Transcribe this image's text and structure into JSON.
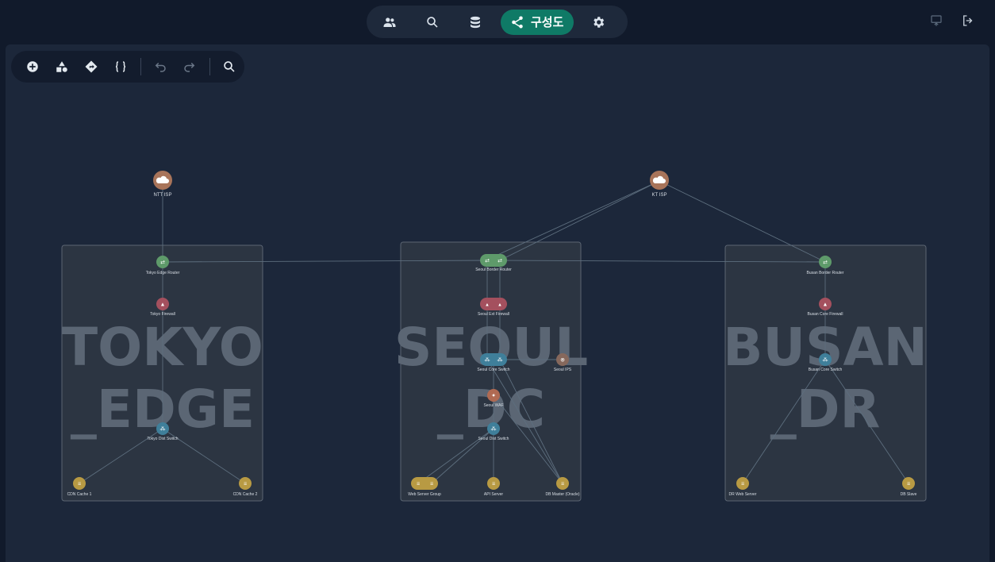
{
  "nav": {
    "items": [
      {
        "name": "users-icon"
      },
      {
        "name": "search-icon"
      },
      {
        "name": "database-icon"
      },
      {
        "name": "share-icon",
        "label": "구성도",
        "active": true
      },
      {
        "name": "gear-icon"
      }
    ],
    "active_color": "#0f7a66"
  },
  "top_right": {
    "icons": [
      "screen-share-icon",
      "logout-icon"
    ]
  },
  "toolbar": {
    "icons": [
      "add-circle-icon",
      "shapes-icon",
      "direction-icon",
      "code-braces-icon",
      "undo-icon",
      "redo-icon",
      "zoom-icon"
    ]
  },
  "diagram": {
    "groups": [
      {
        "id": "tokyo",
        "label_line1": "TOKYO",
        "label_line2": "_EDGE"
      },
      {
        "id": "seoul",
        "label_line1": "SEOUL",
        "label_line2": "_DC"
      },
      {
        "id": "busan",
        "label_line1": "BUSAN",
        "label_line2": "_DR"
      }
    ],
    "nodes": {
      "ntt_isp": "NTT ISP",
      "kt_isp": "KT ISP",
      "tokyo_router": "Tokyo Edge Router",
      "tokyo_fw": "Tokyo Firewall",
      "tokyo_dist": "Tokyo Dist Switch",
      "cdn1": "CDN Cache 1",
      "cdn2": "CDN Cache 2",
      "seoul_router": "Seoul Border Router",
      "seoul_fw": "Seoul Ext Firewall",
      "seoul_core": "Seoul Core Switch",
      "seoul_ips": "Seoul IPS",
      "seoul_waf": "Seoul WAF",
      "seoul_dist": "Seoul Dist Switch",
      "web_group": "Web Server Group",
      "api_server": "API Server",
      "db_master": "DB Master (Oracle)",
      "busan_router": "Busan Border Router",
      "busan_fw": "Busan Core Firewall",
      "busan_core": "Busan Core Switch",
      "dr_web": "DR Web Server",
      "db_slave": "DB Slave"
    },
    "colors": {
      "isp": "#a8745a",
      "router": "#5e9a6a",
      "firewall": "#a4505e",
      "switch": "#3f7f9a",
      "server": "#b89a43",
      "ips": "#86685c",
      "waf": "#b06a52"
    }
  }
}
